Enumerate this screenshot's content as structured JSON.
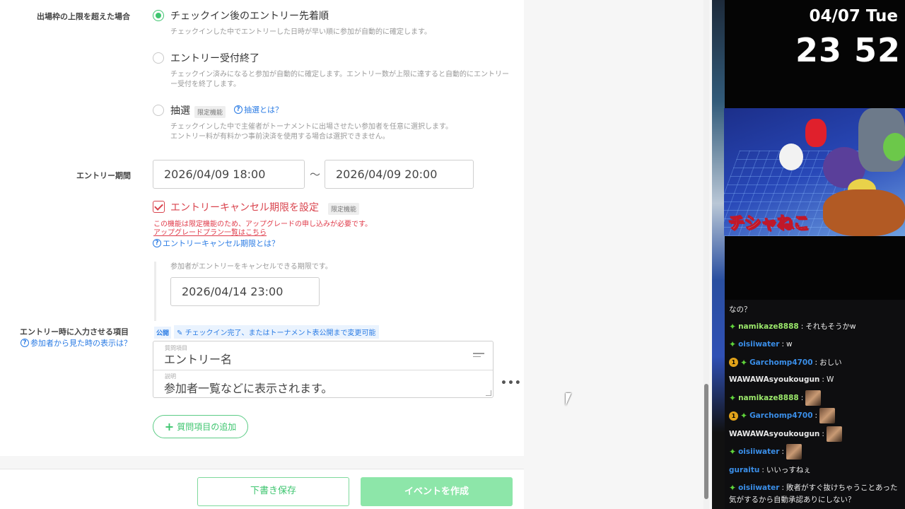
{
  "form": {
    "capacity_label": "出場枠の上限を超えた場合",
    "options": [
      {
        "label": "チェックイン後のエントリー先着順",
        "desc": "チェックインした中でエントリーした日時が早い順に参加が自動的に確定します。"
      },
      {
        "label": "エントリー受付終了",
        "desc1": "チェックイン済みになると参加が自動的に確定します。エントリー数が上限に達すると自動的にエントリー",
        "desc2": "ー受付を終了します。"
      },
      {
        "label": "抽選",
        "tag": "限定機能",
        "help": "抽選とは？",
        "desc1": "チェックインした中で主催者がトーナメントに出場させたい参加者を任意に選択します。",
        "desc2": "エントリー料が有料かつ事前決済を使用する場合は選択できません。"
      }
    ],
    "entry_period_label": "エントリー期間",
    "entry_start": "2026/04/09 18:00",
    "entry_tilde": "〜",
    "entry_end": "2026/04/09 20:00",
    "cancel_checkbox_label": "エントリーキャンセル期限を設定",
    "cancel_tag": "限定機能",
    "upgrade_notice": "この機能は限定機能のため、アップグレードの申し込みが必要です。",
    "upgrade_link": "アップグレードプラン一覧はこちら",
    "cancel_help": "エントリーキャンセル期限とは？",
    "cancel_desc": "参加者がエントリーをキャンセルできる期限です。",
    "cancel_deadline": "2026/04/14 23:00",
    "entry_items_label": "エントリー時に入力させる項目",
    "entry_items_help": "参加者から見た時の表示は？",
    "public_badge": "公開",
    "public_note": "チェックイン完了、またはトーナメント表公開まで変更可能",
    "question_item_label": "質問項目",
    "question_item_value": "エントリー名",
    "description_label": "説明",
    "description_value": "参加者一覧などに表示されます。",
    "more_icon": "•••",
    "add_question_button": "質問項目の追加",
    "draft_button": "下書き保存",
    "create_button": "イベントを作成"
  },
  "overlay": {
    "date": "04/07 Tue",
    "time": "23 52",
    "channel_stamp": "チシャねこ",
    "chat": [
      {
        "user": "",
        "message": "なの？"
      },
      {
        "user": "namikaze8888",
        "message": "それもそうかw",
        "color": "green",
        "sparkle": true
      },
      {
        "user": "oisiiwater",
        "message": "w",
        "color": "blue",
        "sparkle": true
      },
      {
        "user": "Garchomp4700",
        "message": "おしい",
        "color": "blue",
        "sparkle": true,
        "badge": "1"
      },
      {
        "user": "WAWAWAsyoukougun",
        "message": "W",
        "color": "white"
      },
      {
        "user": "namikaze8888",
        "message": "",
        "color": "green",
        "sparkle": true,
        "emote": true
      },
      {
        "user": "Garchomp4700",
        "message": "",
        "color": "blue",
        "sparkle": true,
        "badge": "1",
        "emote": true
      },
      {
        "user": "WAWAWAsyoukougun",
        "message": "",
        "color": "white",
        "emote": true
      },
      {
        "user": "oisiiwater",
        "message": "",
        "color": "blue",
        "sparkle": true,
        "emote": true
      },
      {
        "user": "guraitu",
        "message": "いいっすねぇ",
        "color": "blue"
      },
      {
        "user": "oisiiwater",
        "message": "敗者がすぐ抜けちゃうことあった",
        "color": "blue",
        "sparkle": true
      },
      {
        "user": "",
        "message": "気がするから自動承認ありにしない？"
      }
    ]
  }
}
